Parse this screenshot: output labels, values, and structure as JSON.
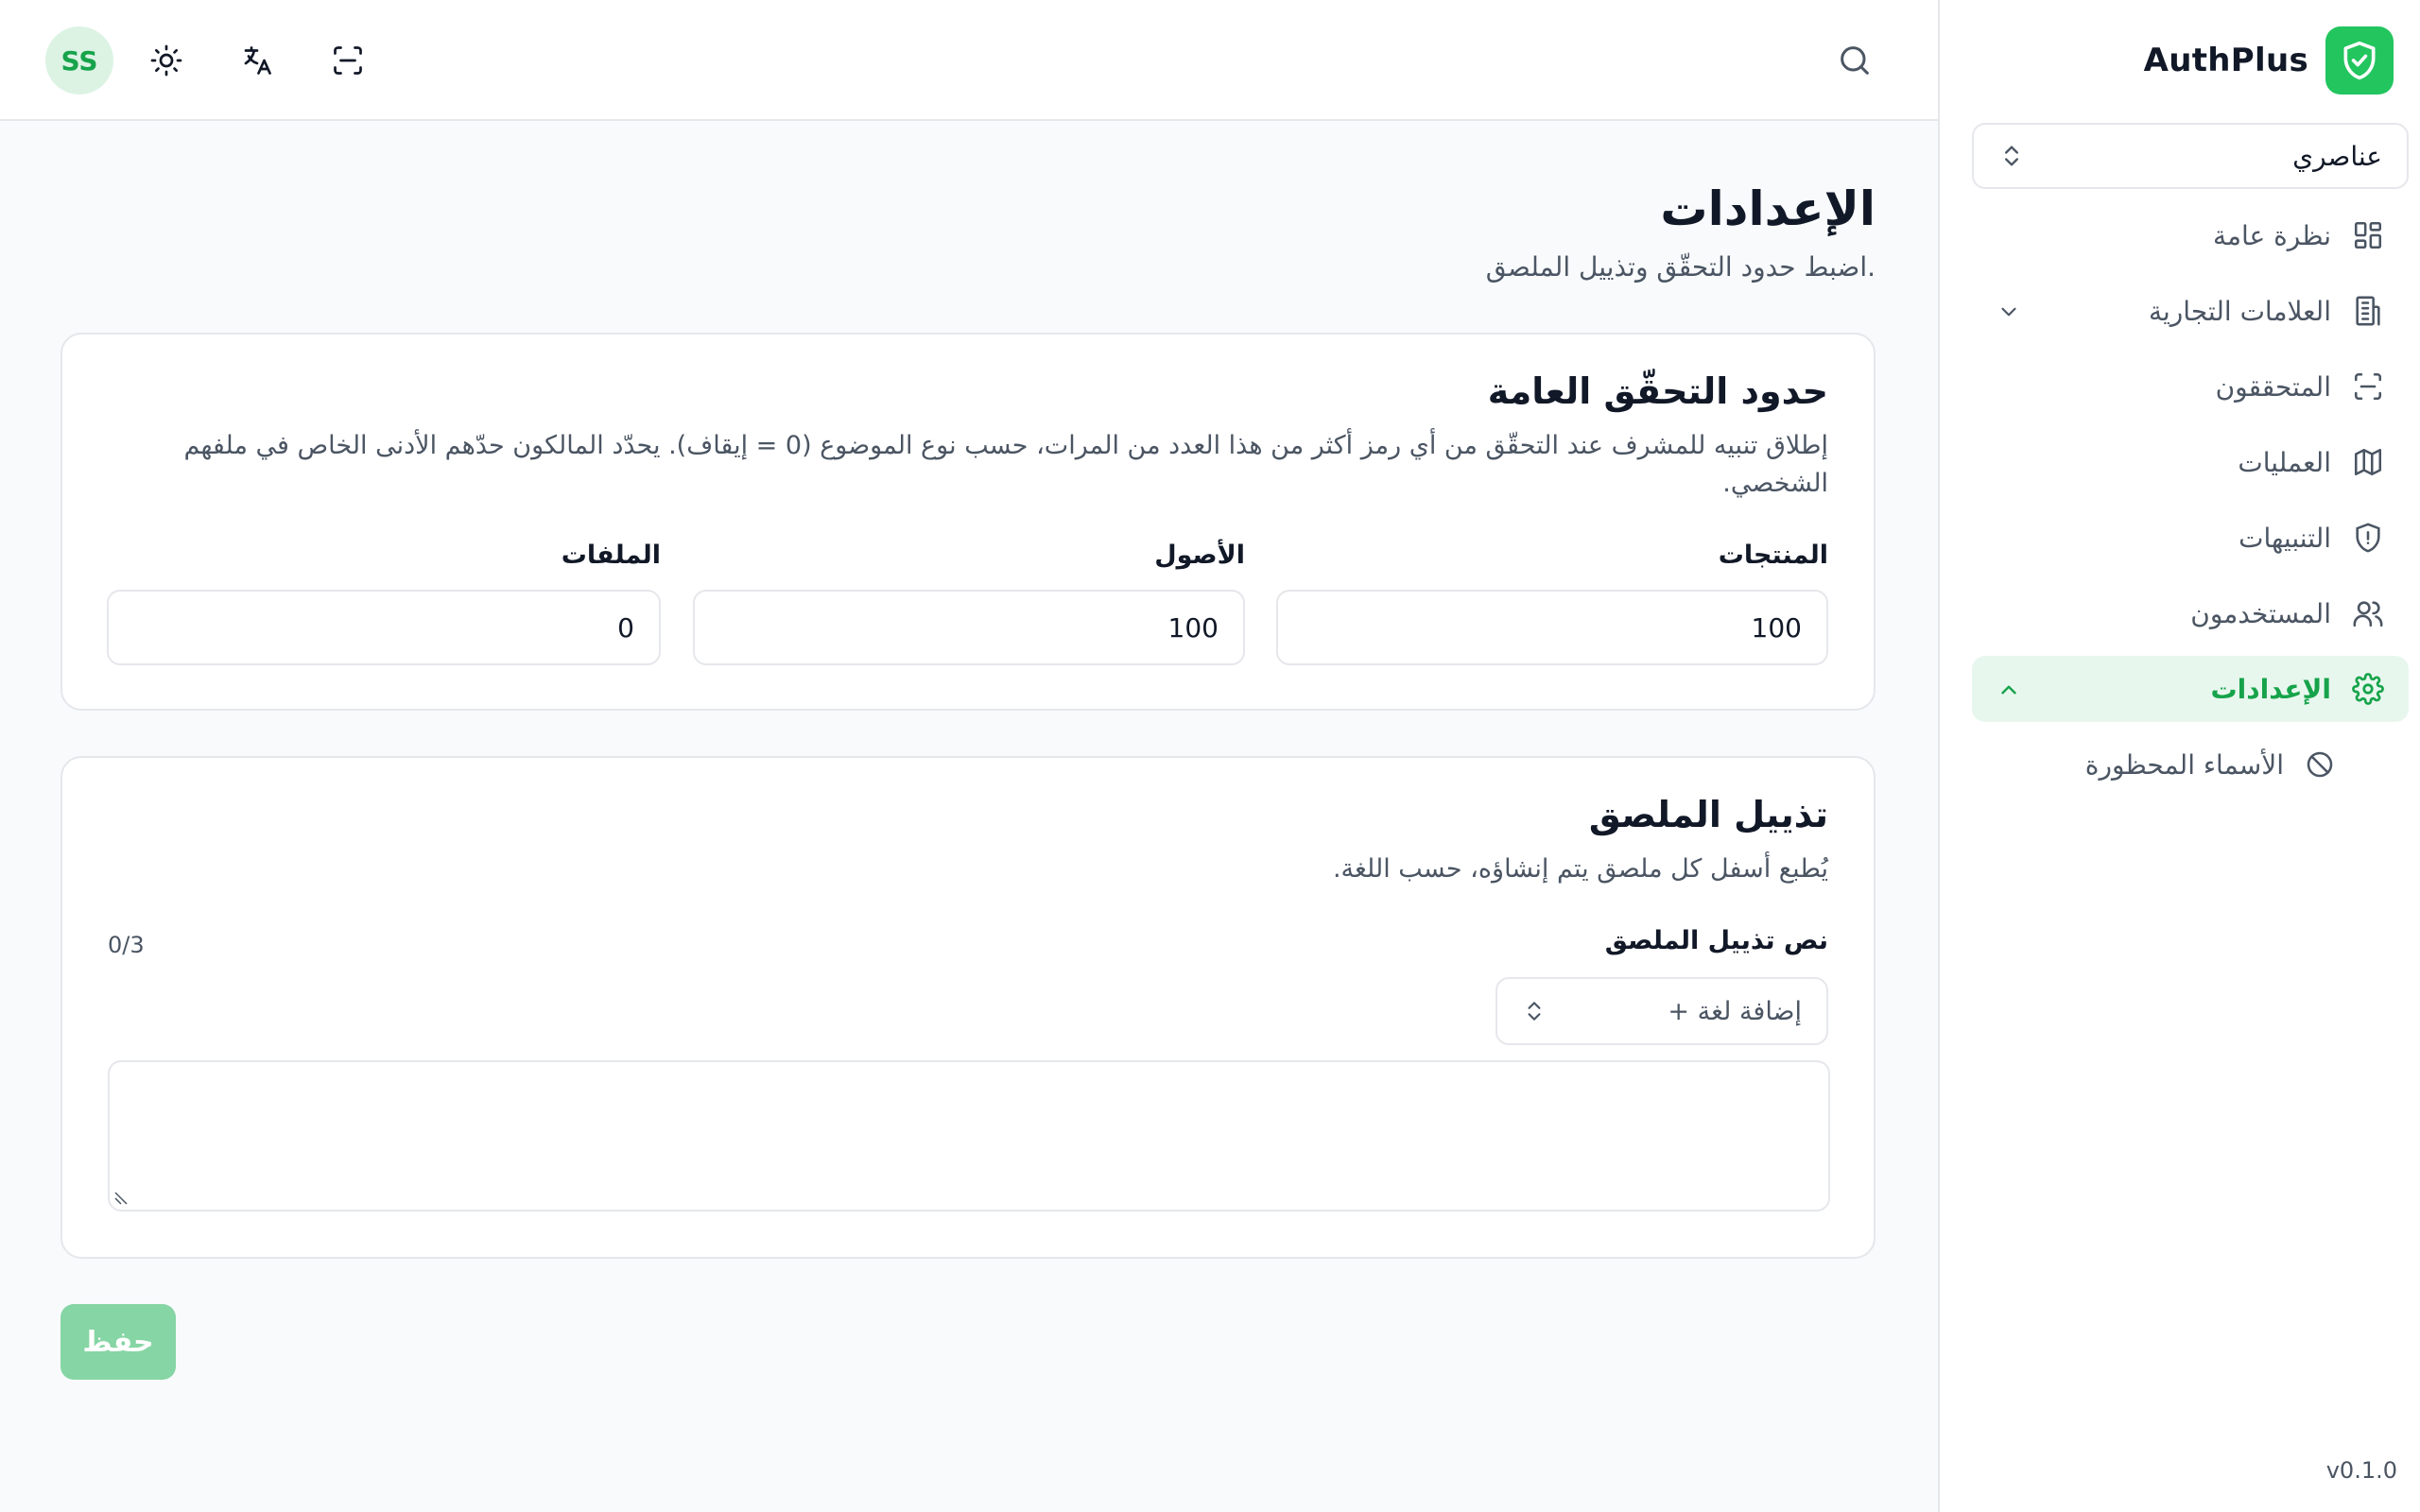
{
  "app": {
    "name": "AuthPlus",
    "version": "v0.1.0"
  },
  "topbar": {
    "avatar_initials": "SS"
  },
  "sidebar": {
    "tenant_selector": "عناصري",
    "items": [
      {
        "label": "نظرة عامة",
        "icon": "grid-icon"
      },
      {
        "label": "العلامات التجارية",
        "icon": "building-icon"
      },
      {
        "label": "المتحققون",
        "icon": "scan-icon"
      },
      {
        "label": "العمليات",
        "icon": "map-icon"
      },
      {
        "label": "التنبيهات",
        "icon": "shield-alert-icon"
      },
      {
        "label": "المستخدمون",
        "icon": "users-icon"
      },
      {
        "label": "الإعدادات",
        "icon": "settings-icon",
        "active": true
      },
      {
        "label": "الأسماء المحظورة",
        "icon": "ban-icon"
      }
    ]
  },
  "page": {
    "title": "الإعدادات",
    "subtitle": "اضبط حدود التحقّق وتذييل الملصق."
  },
  "limits_card": {
    "title": "حدود التحقّق العامة",
    "description": "إطلاق تنبيه للمشرف عند التحقّق من أي رمز أكثر من هذا العدد من المرات، حسب نوع الموضوع (0 = إيقاف). يحدّد المالكون حدّهم الأدنى الخاص في ملفهم الشخصي.",
    "fields": [
      {
        "label": "المنتجات",
        "value": "100"
      },
      {
        "label": "الأصول",
        "value": "100"
      },
      {
        "label": "الملفات",
        "value": "0"
      }
    ]
  },
  "footer_card": {
    "title": "تذييل الملصق",
    "description": "يُطبع أسفل كل ملصق يتم إنشاؤه، حسب اللغة.",
    "field_label": "نص تذييل الملصق",
    "counter": "0/3",
    "add_language": "+ إضافة لغة",
    "text_value": ""
  },
  "actions": {
    "save_label": "حفظ"
  },
  "colors": {
    "accent": "#22c55e",
    "accent_soft": "#e8f7ee",
    "save_disabled": "#86d5a4"
  }
}
